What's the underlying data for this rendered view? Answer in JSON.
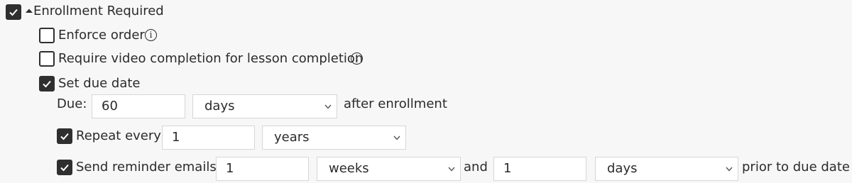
{
  "enrollment": {
    "label": "Enrollment Required",
    "checked": true,
    "expanded": true
  },
  "enforce_order": {
    "label": "Enforce order",
    "checked": false,
    "info_glyph": "i"
  },
  "require_video": {
    "label": "Require video completion for lesson completion",
    "checked": false,
    "info_glyph": "i"
  },
  "set_due_date": {
    "label": "Set due date",
    "checked": true
  },
  "due": {
    "label": "Due:",
    "value": "60",
    "unit": "days",
    "suffix": "after enrollment"
  },
  "repeat": {
    "label": "Repeat every",
    "checked": true,
    "value": "1",
    "unit": "years"
  },
  "reminder": {
    "label": "Send reminder emails",
    "checked": true,
    "value1": "1",
    "unit1": "weeks",
    "and_label": "and",
    "value2": "1",
    "unit2": "days",
    "suffix": "prior to due date"
  },
  "colors": {
    "checkbox_fill": "#2f2f2f",
    "background": "#f7f7f7",
    "field_border": "#d6d6d6",
    "text": "#2b2b2b"
  },
  "icons": [
    "checkmark-icon",
    "caret-up-icon",
    "info-icon",
    "chevron-down-icon"
  ]
}
